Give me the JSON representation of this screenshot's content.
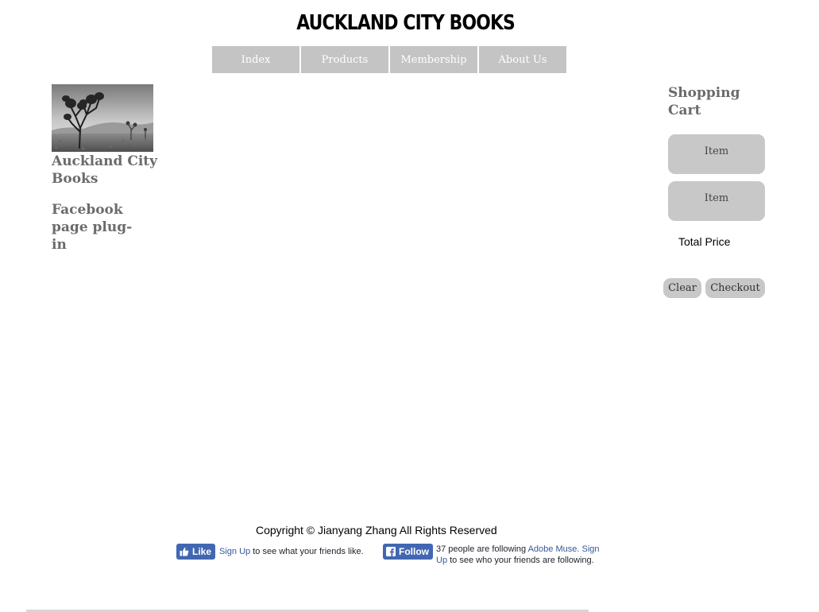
{
  "header": {
    "site_title": "AUCKLAND CITY BOOKS"
  },
  "nav": {
    "items": [
      {
        "label": "Index"
      },
      {
        "label": "Products"
      },
      {
        "label": "Membership"
      },
      {
        "label": "About Us"
      }
    ]
  },
  "sidebar": {
    "logo_icon": "joshua-tree-photo",
    "brand_name": "Auckland City Books",
    "facebook_plugin_text": "Facebook page plug-in"
  },
  "cart": {
    "title": "Shopping Cart",
    "items": [
      {
        "label": "Item"
      },
      {
        "label": "Item"
      }
    ],
    "total_label": "Total Price",
    "clear_label": "Clear",
    "checkout_label": "Checkout"
  },
  "footer": {
    "copyright": "Copyright © Jianyang Zhang All Rights Reserved",
    "like_widget": {
      "button_label": "Like",
      "signup_link": "Sign Up",
      "text": "to see what your friends like."
    },
    "follow_widget": {
      "button_label": "Follow",
      "text_prefix": "37 people are following",
      "page_link": "Adobe Muse.",
      "signup_link": "Sign Up",
      "text_suffix": "to see who your friends are following."
    }
  },
  "colors": {
    "nav_bg": "#c4c4c4",
    "cart_item_bg": "#c8c8c8",
    "heading_gray": "#6b6b6b",
    "facebook_blue": "#4267b2",
    "facebook_link": "#365899"
  }
}
